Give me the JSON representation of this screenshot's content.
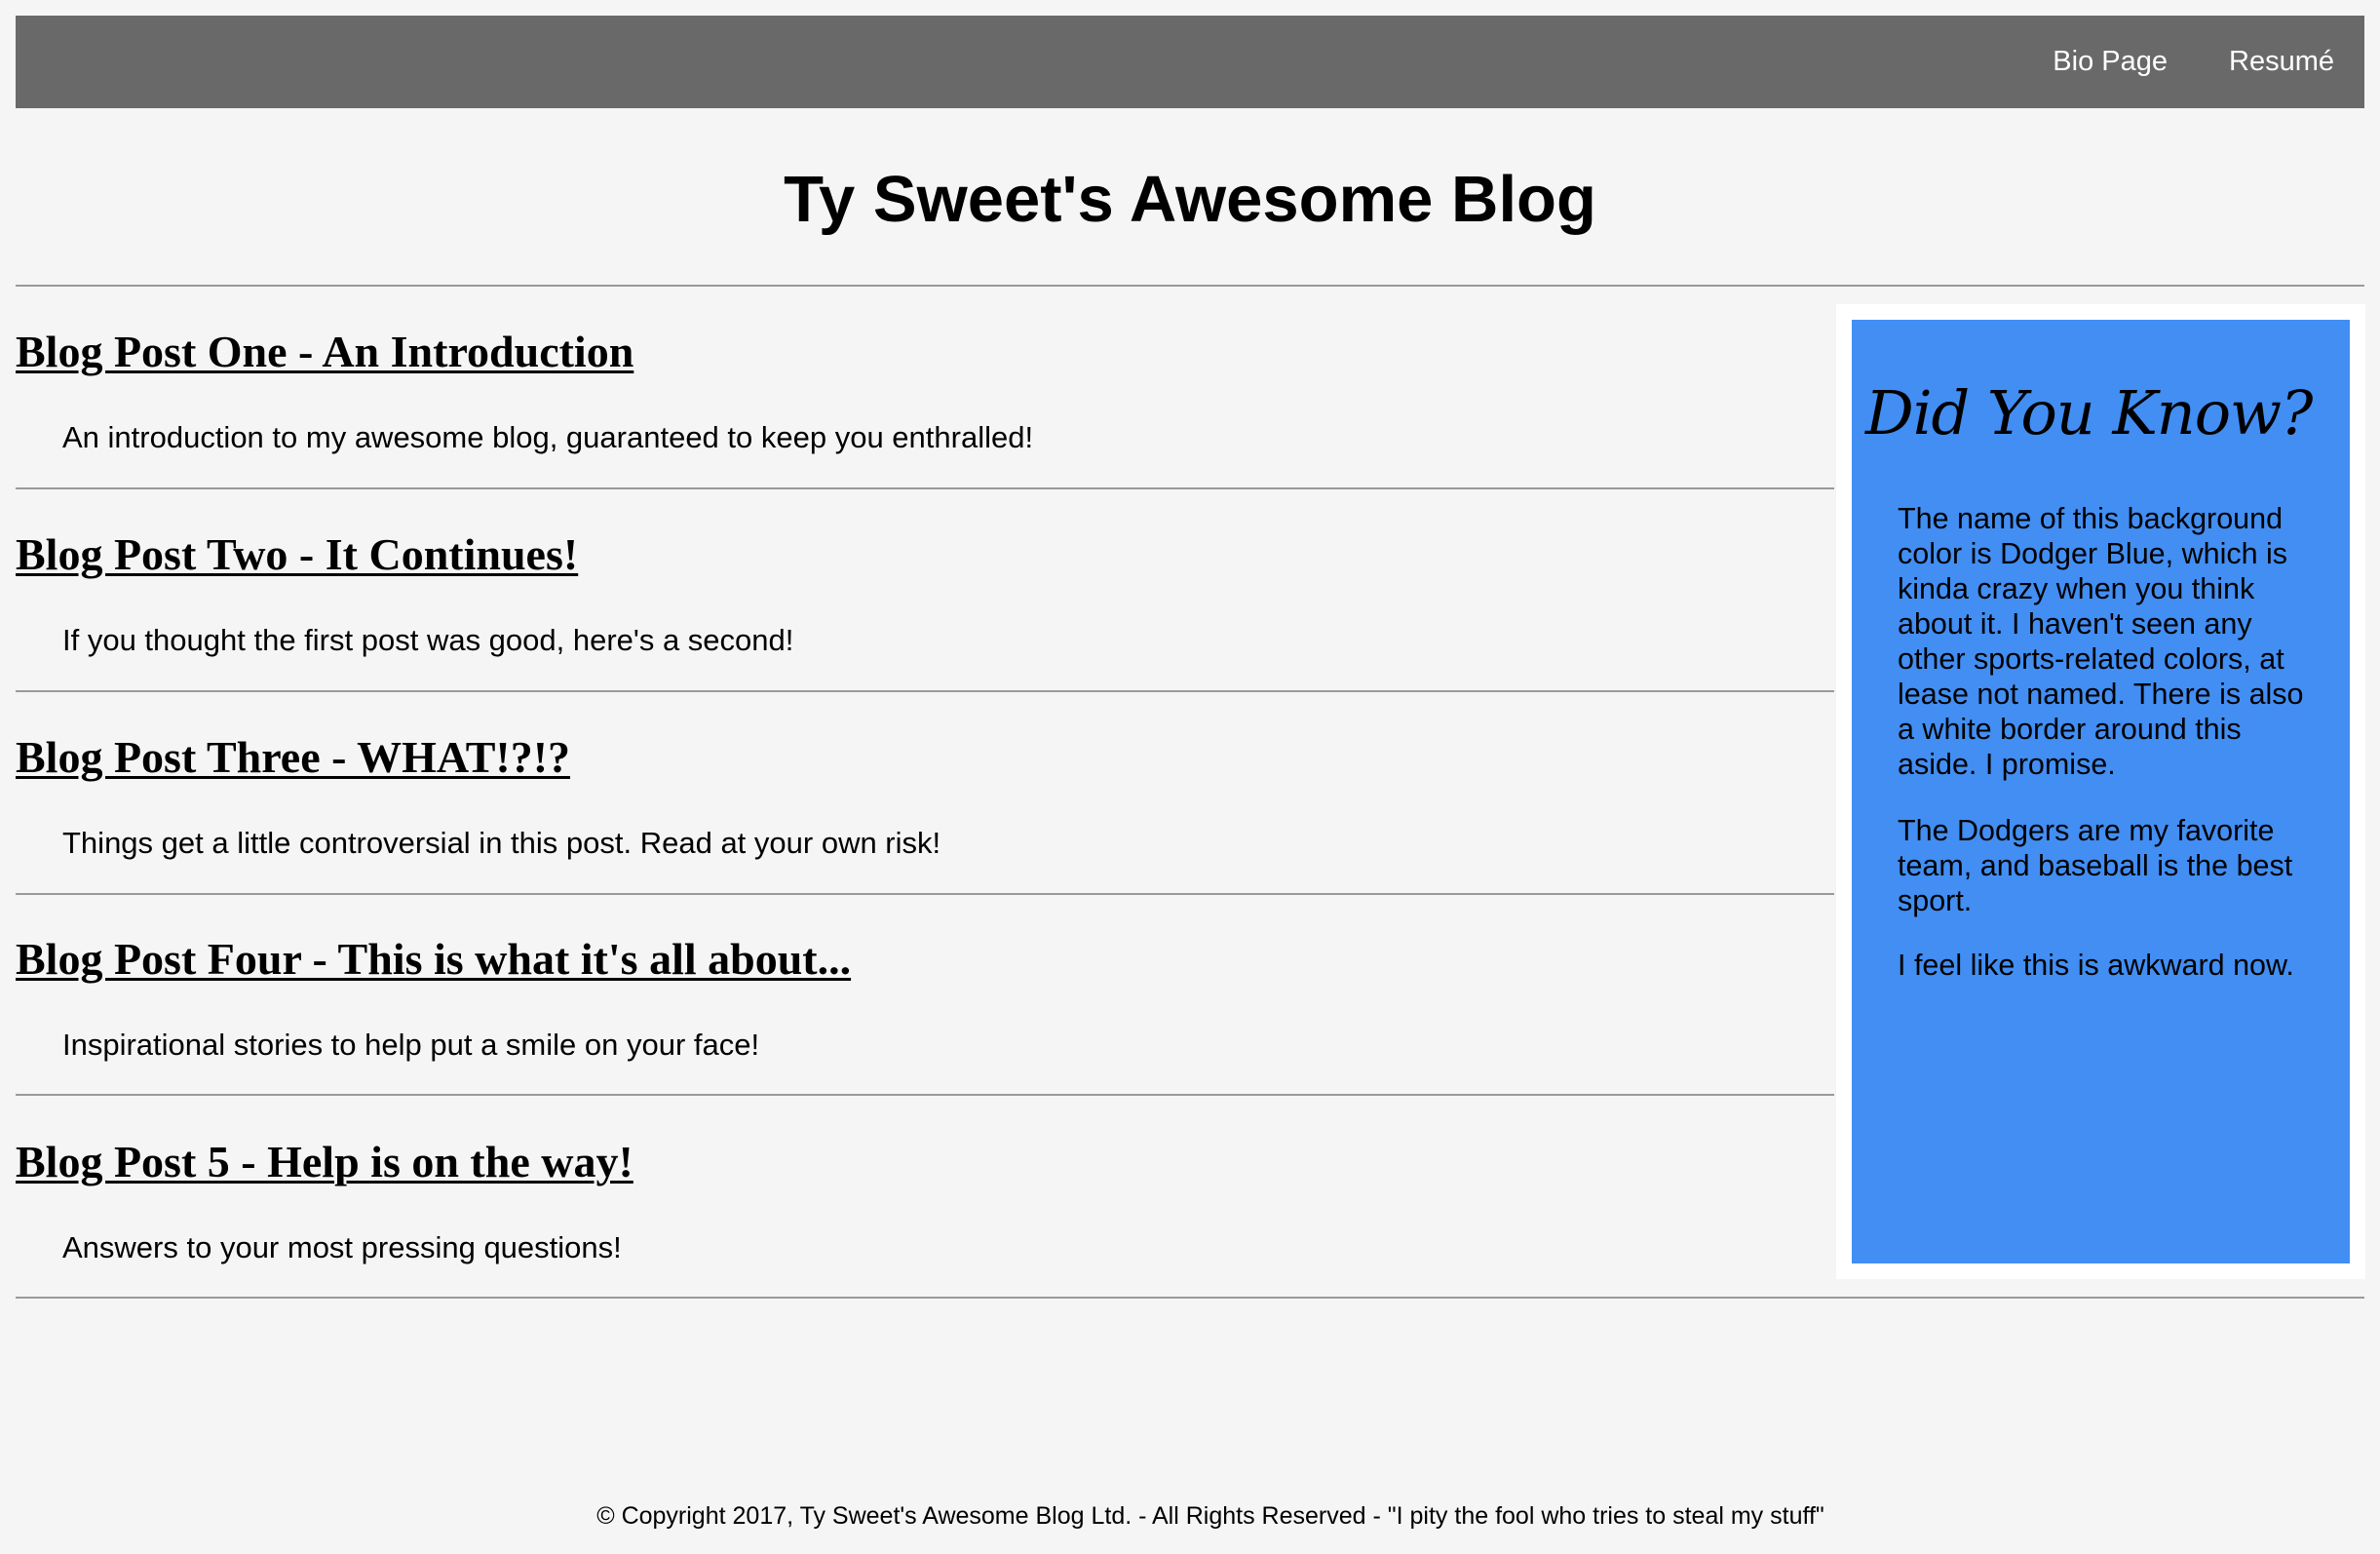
{
  "nav": {
    "links": [
      {
        "label": "Bio Page"
      },
      {
        "label": "Resumé"
      }
    ]
  },
  "header": {
    "title": "Ty Sweet's Awesome Blog"
  },
  "posts": [
    {
      "title": "Blog Post One - An Introduction",
      "summary": "An introduction to my awesome blog, guaranteed to keep you enthralled!"
    },
    {
      "title": "Blog Post Two - It Continues!",
      "summary": "If you thought the first post was good, here's a second!"
    },
    {
      "title": "Blog Post Three - WHAT!?!?",
      "summary": "Things get a little controversial in this post. Read at your own risk!"
    },
    {
      "title": "Blog Post Four - This is what it's all about...",
      "summary": "Inspirational stories to help put a smile on your face!"
    },
    {
      "title": "Blog Post 5 - Help is on the way!",
      "summary": "Answers to your most pressing questions!"
    }
  ],
  "aside": {
    "title": "Did You Know?",
    "paragraphs": [
      "The name of this background color is Dodger Blue, which is kinda crazy when you think about it. I haven't seen any other sports-related colors, at lease not named. There is also a white border around this aside. I promise.",
      "The Dodgers are my favorite team, and baseball is the best sport.",
      "I feel like this is awkward now."
    ]
  },
  "footer": {
    "text": "© Copyright 2017, Ty Sweet's Awesome Blog Ltd. - All Rights Reserved - \"I pity the fool who tries to steal my stuff\""
  },
  "colors": {
    "page_background": "#f5f5f5",
    "nav_background": "#696969",
    "nav_text": "#ffffff",
    "aside_background": "#428ef3",
    "aside_border": "#ffffff",
    "divider": "#9a9a9a"
  }
}
